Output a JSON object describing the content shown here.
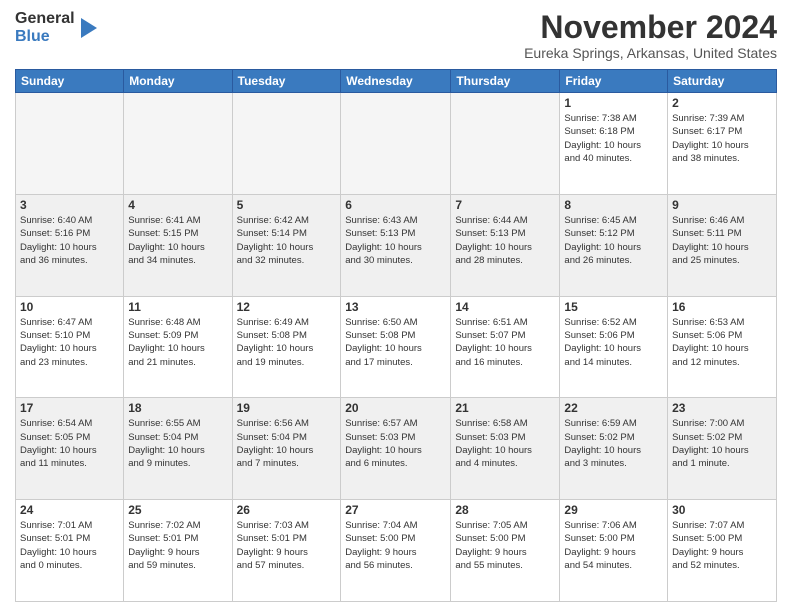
{
  "logo": {
    "general": "General",
    "blue": "Blue"
  },
  "title": "November 2024",
  "location": "Eureka Springs, Arkansas, United States",
  "days_of_week": [
    "Sunday",
    "Monday",
    "Tuesday",
    "Wednesday",
    "Thursday",
    "Friday",
    "Saturday"
  ],
  "weeks": [
    [
      {
        "day": "",
        "info": "",
        "empty": true
      },
      {
        "day": "",
        "info": "",
        "empty": true
      },
      {
        "day": "",
        "info": "",
        "empty": true
      },
      {
        "day": "",
        "info": "",
        "empty": true
      },
      {
        "day": "",
        "info": "",
        "empty": true
      },
      {
        "day": "1",
        "info": "Sunrise: 7:38 AM\nSunset: 6:18 PM\nDaylight: 10 hours\nand 40 minutes."
      },
      {
        "day": "2",
        "info": "Sunrise: 7:39 AM\nSunset: 6:17 PM\nDaylight: 10 hours\nand 38 minutes."
      }
    ],
    [
      {
        "day": "3",
        "info": "Sunrise: 6:40 AM\nSunset: 5:16 PM\nDaylight: 10 hours\nand 36 minutes.",
        "shaded": true
      },
      {
        "day": "4",
        "info": "Sunrise: 6:41 AM\nSunset: 5:15 PM\nDaylight: 10 hours\nand 34 minutes.",
        "shaded": true
      },
      {
        "day": "5",
        "info": "Sunrise: 6:42 AM\nSunset: 5:14 PM\nDaylight: 10 hours\nand 32 minutes.",
        "shaded": true
      },
      {
        "day": "6",
        "info": "Sunrise: 6:43 AM\nSunset: 5:13 PM\nDaylight: 10 hours\nand 30 minutes.",
        "shaded": true
      },
      {
        "day": "7",
        "info": "Sunrise: 6:44 AM\nSunset: 5:13 PM\nDaylight: 10 hours\nand 28 minutes.",
        "shaded": true
      },
      {
        "day": "8",
        "info": "Sunrise: 6:45 AM\nSunset: 5:12 PM\nDaylight: 10 hours\nand 26 minutes.",
        "shaded": true
      },
      {
        "day": "9",
        "info": "Sunrise: 6:46 AM\nSunset: 5:11 PM\nDaylight: 10 hours\nand 25 minutes.",
        "shaded": true
      }
    ],
    [
      {
        "day": "10",
        "info": "Sunrise: 6:47 AM\nSunset: 5:10 PM\nDaylight: 10 hours\nand 23 minutes."
      },
      {
        "day": "11",
        "info": "Sunrise: 6:48 AM\nSunset: 5:09 PM\nDaylight: 10 hours\nand 21 minutes."
      },
      {
        "day": "12",
        "info": "Sunrise: 6:49 AM\nSunset: 5:08 PM\nDaylight: 10 hours\nand 19 minutes."
      },
      {
        "day": "13",
        "info": "Sunrise: 6:50 AM\nSunset: 5:08 PM\nDaylight: 10 hours\nand 17 minutes."
      },
      {
        "day": "14",
        "info": "Sunrise: 6:51 AM\nSunset: 5:07 PM\nDaylight: 10 hours\nand 16 minutes."
      },
      {
        "day": "15",
        "info": "Sunrise: 6:52 AM\nSunset: 5:06 PM\nDaylight: 10 hours\nand 14 minutes."
      },
      {
        "day": "16",
        "info": "Sunrise: 6:53 AM\nSunset: 5:06 PM\nDaylight: 10 hours\nand 12 minutes."
      }
    ],
    [
      {
        "day": "17",
        "info": "Sunrise: 6:54 AM\nSunset: 5:05 PM\nDaylight: 10 hours\nand 11 minutes.",
        "shaded": true
      },
      {
        "day": "18",
        "info": "Sunrise: 6:55 AM\nSunset: 5:04 PM\nDaylight: 10 hours\nand 9 minutes.",
        "shaded": true
      },
      {
        "day": "19",
        "info": "Sunrise: 6:56 AM\nSunset: 5:04 PM\nDaylight: 10 hours\nand 7 minutes.",
        "shaded": true
      },
      {
        "day": "20",
        "info": "Sunrise: 6:57 AM\nSunset: 5:03 PM\nDaylight: 10 hours\nand 6 minutes.",
        "shaded": true
      },
      {
        "day": "21",
        "info": "Sunrise: 6:58 AM\nSunset: 5:03 PM\nDaylight: 10 hours\nand 4 minutes.",
        "shaded": true
      },
      {
        "day": "22",
        "info": "Sunrise: 6:59 AM\nSunset: 5:02 PM\nDaylight: 10 hours\nand 3 minutes.",
        "shaded": true
      },
      {
        "day": "23",
        "info": "Sunrise: 7:00 AM\nSunset: 5:02 PM\nDaylight: 10 hours\nand 1 minute.",
        "shaded": true
      }
    ],
    [
      {
        "day": "24",
        "info": "Sunrise: 7:01 AM\nSunset: 5:01 PM\nDaylight: 10 hours\nand 0 minutes."
      },
      {
        "day": "25",
        "info": "Sunrise: 7:02 AM\nSunset: 5:01 PM\nDaylight: 9 hours\nand 59 minutes."
      },
      {
        "day": "26",
        "info": "Sunrise: 7:03 AM\nSunset: 5:01 PM\nDaylight: 9 hours\nand 57 minutes."
      },
      {
        "day": "27",
        "info": "Sunrise: 7:04 AM\nSunset: 5:00 PM\nDaylight: 9 hours\nand 56 minutes."
      },
      {
        "day": "28",
        "info": "Sunrise: 7:05 AM\nSunset: 5:00 PM\nDaylight: 9 hours\nand 55 minutes."
      },
      {
        "day": "29",
        "info": "Sunrise: 7:06 AM\nSunset: 5:00 PM\nDaylight: 9 hours\nand 54 minutes."
      },
      {
        "day": "30",
        "info": "Sunrise: 7:07 AM\nSunset: 5:00 PM\nDaylight: 9 hours\nand 52 minutes."
      }
    ]
  ]
}
